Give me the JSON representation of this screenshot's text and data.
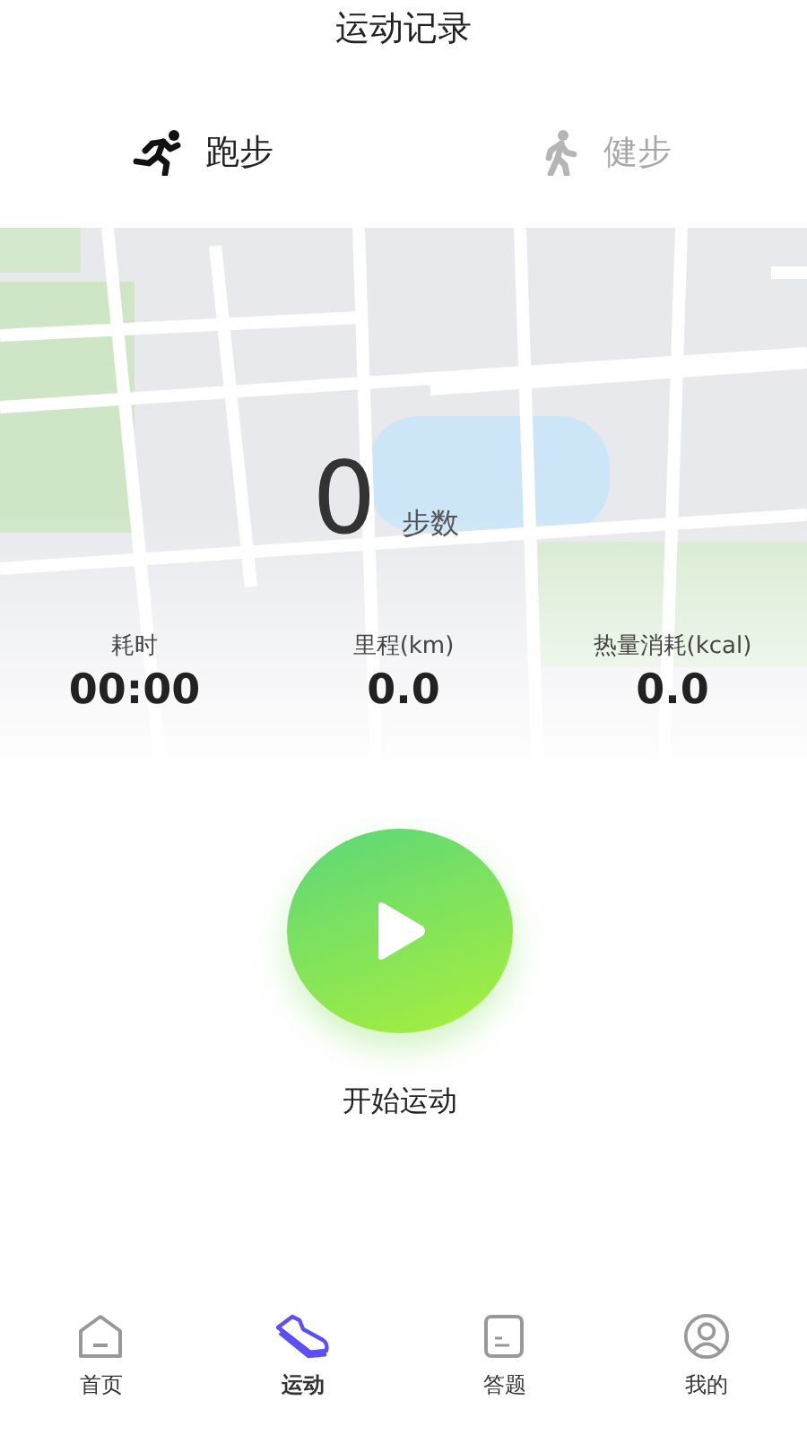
{
  "header": {
    "title": "运动记录"
  },
  "tabs": [
    {
      "label": "跑步",
      "kind": "run",
      "selected": true
    },
    {
      "label": "健步",
      "kind": "walk",
      "selected": false
    }
  ],
  "steps": {
    "value": "0",
    "unit": "步数"
  },
  "stats": [
    {
      "label": "耗时",
      "value": "00:00"
    },
    {
      "label": "里程(km)",
      "value": "0.0"
    },
    {
      "label": "热量消耗(kcal)",
      "value": "0.0"
    }
  ],
  "start": {
    "label": "开始运动"
  },
  "nav": [
    {
      "label": "首页",
      "kind": "home",
      "selected": false
    },
    {
      "label": "运动",
      "kind": "shoe",
      "selected": true
    },
    {
      "label": "答题",
      "kind": "sheet",
      "selected": false
    },
    {
      "label": "我的",
      "kind": "user",
      "selected": false
    }
  ]
}
